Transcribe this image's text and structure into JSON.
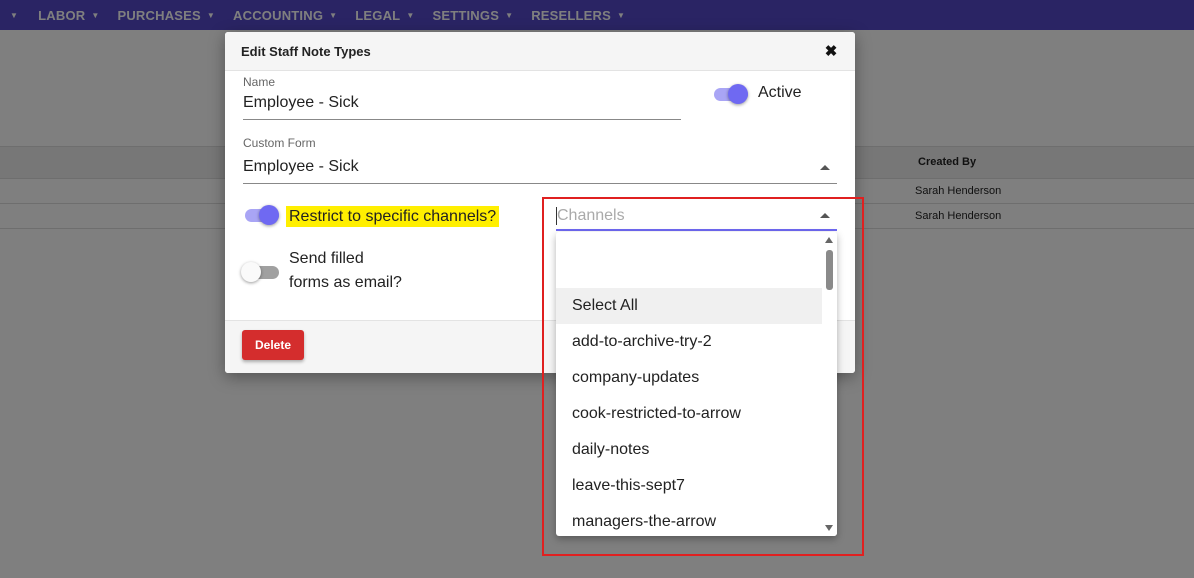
{
  "nav": {
    "items": [
      {
        "label": "LABOR"
      },
      {
        "label": "PURCHASES"
      },
      {
        "label": "ACCOUNTING"
      },
      {
        "label": "LEGAL"
      },
      {
        "label": "SETTINGS"
      },
      {
        "label": "RESELLERS"
      }
    ]
  },
  "background_table": {
    "column_header": "Created By",
    "rows": [
      {
        "created_by": "Sarah Henderson"
      },
      {
        "created_by": "Sarah Henderson"
      }
    ]
  },
  "modal": {
    "title": "Edit Staff Note Types",
    "close_icon": "close-icon",
    "name_label": "Name",
    "name_value": "Employee - Sick",
    "active_label": "Active",
    "active_on": true,
    "custom_form_label": "Custom Form",
    "custom_form_value": "Employee - Sick",
    "restrict_label": "Restrict to specific channels?",
    "restrict_on": true,
    "send_email_label_line1": "Send filled",
    "send_email_label_line2": "forms as email?",
    "send_email_on": false,
    "delete_label": "Delete",
    "channels_placeholder": "Channels"
  },
  "dropdown": {
    "options": [
      "Select All",
      "add-to-archive-try-2",
      "company-updates",
      "cook-restricted-to-arrow",
      "daily-notes",
      "leave-this-sept7",
      "managers-the-arrow"
    ]
  },
  "colors": {
    "nav": "#5448c8",
    "accent": "#6f69f2",
    "delete": "#d42d2d",
    "highlight": "#ffef00",
    "annotation": "#e02020"
  }
}
